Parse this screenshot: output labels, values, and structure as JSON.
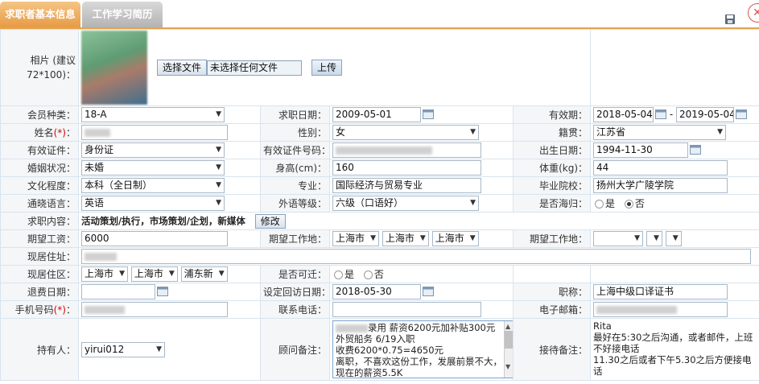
{
  "tabs": [
    {
      "label": "求职者基本信息",
      "active": true
    },
    {
      "label": "工作学习简历",
      "active": false
    }
  ],
  "photo": {
    "label": "相片 (建议72*100)：",
    "file_button": "选择文件",
    "file_status": "未选择任何文件",
    "upload_button": "上传"
  },
  "fields": {
    "member_type": {
      "label": "会员种类：",
      "value": "18-A"
    },
    "apply_date": {
      "label": "求职日期：",
      "value": "2009-05-01"
    },
    "validity": {
      "label": "有效期：",
      "from": "2018-05-04",
      "sep": "-",
      "to": "2019-05-04"
    },
    "name": {
      "label": "姓名",
      "req": "(*)",
      "colon": "："
    },
    "gender": {
      "label": "性别：",
      "value": "女"
    },
    "native_place": {
      "label": "籍贯：",
      "value": "江苏省"
    },
    "id_type": {
      "label": "有效证件：",
      "value": "身份证"
    },
    "id_number": {
      "label": "有效证件号码："
    },
    "birth_date": {
      "label": "出生日期：",
      "value": "1994-11-30"
    },
    "marital": {
      "label": "婚姻状况：",
      "value": "未婚"
    },
    "height": {
      "label": "身高(cm)：",
      "value": "160"
    },
    "weight": {
      "label": "体重(kg)：",
      "value": "44"
    },
    "education": {
      "label": "文化程度：",
      "value": "本科（全日制）"
    },
    "major": {
      "label": "专业：",
      "value": "国际经济与贸易专业"
    },
    "school": {
      "label": "毕业院校：",
      "value": "扬州大学广陵学院"
    },
    "language": {
      "label": "通晓语言：",
      "value": "英语"
    },
    "lang_level": {
      "label": "外语等级：",
      "value": "六级（口语好）"
    },
    "overseas": {
      "label": "是否海归：",
      "opt_yes": "是",
      "opt_no": "否",
      "selected": "否"
    },
    "job_content": {
      "label": "求职内容：",
      "value": "活动策划/执行，市场策划/企划，新媒体",
      "edit_button": "修改"
    },
    "salary": {
      "label": "期望工资：",
      "value": "6000"
    },
    "work_place": {
      "label": "期望工作地：",
      "province": "上海市",
      "city": "上海市",
      "district": "上海市"
    },
    "work_place2": {
      "label": "期望工作地："
    },
    "address": {
      "label": "现居住址："
    },
    "residence": {
      "label": "现居住区：",
      "province": "上海市",
      "city": "上海市",
      "district": "浦东新"
    },
    "relocate": {
      "label": "是否可迁：",
      "opt_yes": "是",
      "opt_no": "否"
    },
    "refund_date": {
      "label": "退费日期："
    },
    "revisit_date": {
      "label": "设定回访日期：",
      "value": "2018-05-30"
    },
    "title": {
      "label": "职称：",
      "value": "上海中级口译证书"
    },
    "mobile": {
      "label": "手机号码",
      "req": "(*)",
      "colon": "："
    },
    "phone": {
      "label": "联系电话："
    },
    "email": {
      "label": "电子邮箱："
    },
    "holder": {
      "label": "持有人：",
      "value": "yirui012"
    },
    "consultant_note": {
      "label": "顾问备注：",
      "lines": [
        "录用  薪资6200元加补贴300元  外贸船务  6/19入职",
        "收费6200*0.75=4650元",
        "离职，不喜欢这份工作，发展前景不大，现在的薪资5.5K"
      ]
    },
    "reception_note": {
      "label": "接待备注：",
      "lines": [
        "Rita",
        "最好在5:30之后沟通，或者邮件，上班不好接电话",
        "11.30之后或者下午5.30之后方便接电话"
      ]
    }
  },
  "colors": {
    "tab_active": "#e69b45",
    "tab_inactive": "#b3b3b3",
    "border": "#d9e4ee",
    "label_bg": "#f4f6f8",
    "required": "#dd0000"
  }
}
